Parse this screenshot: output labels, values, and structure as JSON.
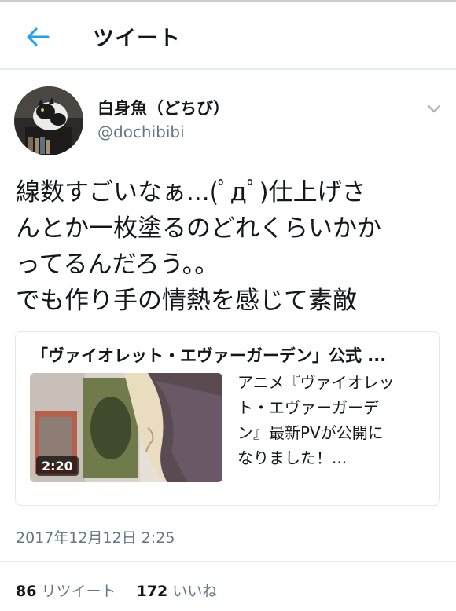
{
  "header": {
    "back_icon": "arrow-left-icon",
    "title": "ツイート",
    "accent_color": "#1da1f2"
  },
  "tweet": {
    "author": {
      "display_name": "白身魚（どちび）",
      "handle": "@dochibibi",
      "avatar": "avatar-cat-photo"
    },
    "menu_icon": "chevron-down-icon",
    "text_lines": [
      "線数すごいなぁ...(ﾟдﾟ)仕上げさ",
      "んとか一枚塗るのどれくらいかか",
      "ってるんだろう。。",
      "でも作り手の情熱を感じて素敵"
    ],
    "card": {
      "title": "「ヴァイオレット・エヴァーガーデン」公式 ...",
      "duration": "2:20",
      "description_lines": [
        "アニメ『ヴァイオレッ",
        "ト・エヴァーガーデ",
        "ン』最新PVが公開に",
        "なりました！..."
      ]
    },
    "timestamp": "2017年12月12日 2:25",
    "stats": {
      "retweets_count": "86",
      "retweets_label": "リツイート",
      "likes_count": "172",
      "likes_label": "いいね"
    }
  }
}
